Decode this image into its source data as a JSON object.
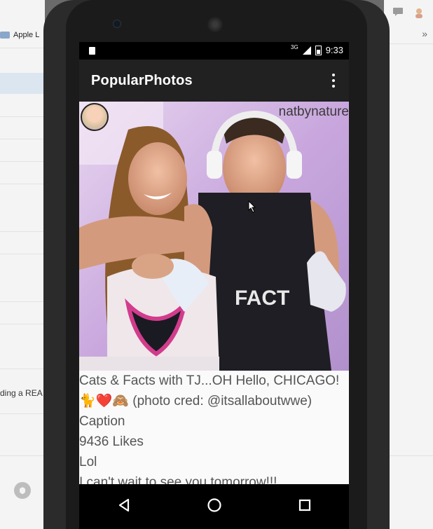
{
  "background": {
    "bookmark_label": "Apple L",
    "left_snippet": "ding a REA",
    "chevron": "»",
    "comment_icon": "comment-icon",
    "profile_icon": "profile-icon",
    "github_icon": "github-icon"
  },
  "statusbar": {
    "network": "3G",
    "time": "9:33"
  },
  "app": {
    "title": "PopularPhotos"
  },
  "post": {
    "username": "natbynature",
    "caption": "Cats & Facts with TJ...OH Hello, CHICAGO! 🐈❤️🙈​ (photo cred: @itsallaboutwwe)  Caption",
    "likes": "9436 Likes",
    "comments": [
      "Lol",
      "I can't wait to see you tomorrow!!!"
    ],
    "shirt_text": "FACT"
  },
  "colors": {
    "actionbar": "#212121",
    "statusbar": "#000000",
    "screen_bg": "#fafafa",
    "text": "#555555"
  }
}
